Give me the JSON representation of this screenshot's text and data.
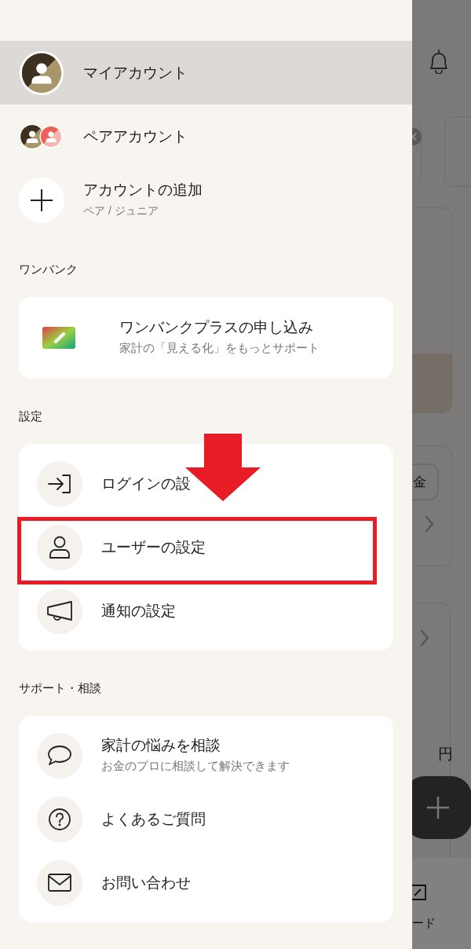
{
  "accounts": [
    {
      "kind": "my",
      "label": "マイアカウント",
      "selected": true
    },
    {
      "kind": "pair",
      "label": "ペアアカウント",
      "selected": false
    },
    {
      "kind": "add",
      "label": "アカウントの追加",
      "sublabel": "ペア / ジュニア",
      "selected": false
    }
  ],
  "sections": [
    {
      "heading": "ワンバンク",
      "items": [
        {
          "kind": "card",
          "label": "ワンバンクプラスの申し込み",
          "sublabel": "家計の「見える化」をもっとサポート",
          "highlighted": false
        }
      ]
    },
    {
      "heading": "設定",
      "items": [
        {
          "kind": "login",
          "label": "ログインの設",
          "highlighted": false
        },
        {
          "kind": "user",
          "label": "ユーザーの設定",
          "highlighted": true
        },
        {
          "kind": "megaphone",
          "label": "通知の設定",
          "highlighted": false
        }
      ]
    },
    {
      "heading": "サポート・相談",
      "items": [
        {
          "kind": "chat",
          "label": "家計の悩みを相談",
          "sublabel": "お金のプロに相談して解決できます",
          "highlighted": false
        },
        {
          "kind": "question",
          "label": "よくあるご質問",
          "highlighted": false
        },
        {
          "kind": "mail",
          "label": "お問い合わせ",
          "highlighted": false
        }
      ]
    }
  ],
  "background": {
    "button_text": "金",
    "unit": "円",
    "tab_label": "ード"
  }
}
